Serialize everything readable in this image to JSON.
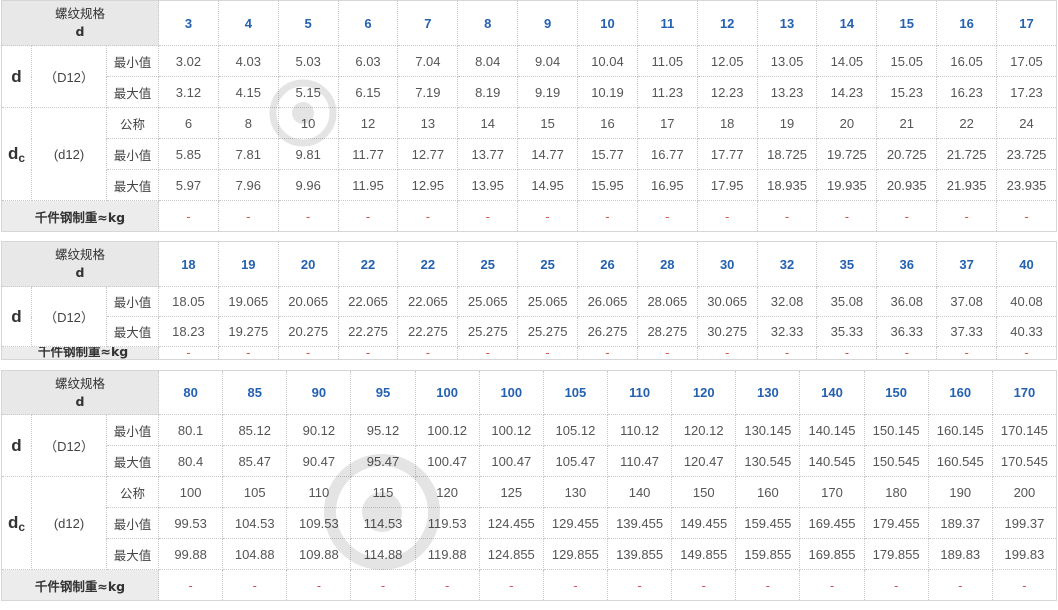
{
  "blocks": [
    {
      "thread_label": "螺纹规格",
      "thread_symbol": "d",
      "sizes": [
        "3",
        "4",
        "5",
        "6",
        "7",
        "8",
        "9",
        "10",
        "11",
        "12",
        "13",
        "14",
        "15",
        "16",
        "17"
      ],
      "d": {
        "symbol": "d",
        "tolerance": "（D12）",
        "rows": [
          {
            "label": "最小值",
            "values": [
              "3.02",
              "4.03",
              "5.03",
              "6.03",
              "7.04",
              "8.04",
              "9.04",
              "10.04",
              "11.05",
              "12.05",
              "13.05",
              "14.05",
              "15.05",
              "16.05",
              "17.05"
            ]
          },
          {
            "label": "最大值",
            "values": [
              "3.12",
              "4.15",
              "5.15",
              "6.15",
              "7.19",
              "8.19",
              "9.19",
              "10.19",
              "11.23",
              "12.23",
              "13.23",
              "14.23",
              "15.23",
              "16.23",
              "17.23"
            ]
          }
        ]
      },
      "dc": {
        "symbol": "d",
        "subscript": "c",
        "tolerance": "(d12)",
        "rows": [
          {
            "label": "公称",
            "values": [
              "6",
              "8",
              "10",
              "12",
              "13",
              "14",
              "15",
              "16",
              "17",
              "18",
              "19",
              "20",
              "21",
              "22",
              "24"
            ]
          },
          {
            "label": "最小值",
            "values": [
              "5.85",
              "7.81",
              "9.81",
              "11.77",
              "12.77",
              "13.77",
              "14.77",
              "15.77",
              "16.77",
              "17.77",
              "18.725",
              "19.725",
              "20.725",
              "21.725",
              "23.725"
            ]
          },
          {
            "label": "最大值",
            "values": [
              "5.97",
              "7.96",
              "9.96",
              "11.95",
              "12.95",
              "13.95",
              "14.95",
              "15.95",
              "16.95",
              "17.95",
              "18.935",
              "19.935",
              "20.935",
              "21.935",
              "23.935"
            ]
          }
        ]
      },
      "weight": {
        "label": "千件钢制重≈kg",
        "values": [
          "-",
          "-",
          "-",
          "-",
          "-",
          "-",
          "-",
          "-",
          "-",
          "-",
          "-",
          "-",
          "-",
          "-",
          "-"
        ]
      }
    },
    {
      "thread_label": "螺纹规格",
      "thread_symbol": "d",
      "sizes": [
        "18",
        "19",
        "20",
        "22",
        "22",
        "25",
        "25",
        "26",
        "28",
        "30",
        "32",
        "35",
        "36",
        "37",
        "40"
      ],
      "d": {
        "symbol": "d",
        "tolerance": "（D12）",
        "rows": [
          {
            "label": "最小值",
            "values": [
              "18.05",
              "19.065",
              "20.065",
              "22.065",
              "22.065",
              "25.065",
              "25.065",
              "26.065",
              "28.065",
              "30.065",
              "32.08",
              "35.08",
              "36.08",
              "37.08",
              "40.08"
            ]
          },
          {
            "label": "最大值",
            "values": [
              "18.23",
              "19.275",
              "20.275",
              "22.275",
              "22.275",
              "25.275",
              "25.275",
              "26.275",
              "28.275",
              "30.275",
              "32.33",
              "35.33",
              "36.33",
              "37.33",
              "40.33"
            ]
          }
        ]
      },
      "weight": {
        "label": "千件钢制重≈kg",
        "values": [
          "-",
          "-",
          "-",
          "-",
          "-",
          "-",
          "-",
          "-",
          "-",
          "-",
          "-",
          "-",
          "-",
          "-",
          "-"
        ]
      }
    },
    {
      "thread_label": "螺纹规格",
      "thread_symbol": "d",
      "sizes": [
        "80",
        "85",
        "90",
        "95",
        "100",
        "100",
        "105",
        "110",
        "120",
        "130",
        "140",
        "150",
        "160",
        "170"
      ],
      "d": {
        "symbol": "d",
        "tolerance": "（D12）",
        "rows": [
          {
            "label": "最小值",
            "values": [
              "80.1",
              "85.12",
              "90.12",
              "95.12",
              "100.12",
              "100.12",
              "105.12",
              "110.12",
              "120.12",
              "130.145",
              "140.145",
              "150.145",
              "160.145",
              "170.145"
            ]
          },
          {
            "label": "最大值",
            "values": [
              "80.4",
              "85.47",
              "90.47",
              "95.47",
              "100.47",
              "100.47",
              "105.47",
              "110.47",
              "120.47",
              "130.545",
              "140.545",
              "150.545",
              "160.545",
              "170.545"
            ]
          }
        ]
      },
      "dc": {
        "symbol": "d",
        "subscript": "c",
        "tolerance": "(d12)",
        "rows": [
          {
            "label": "公称",
            "values": [
              "100",
              "105",
              "110",
              "115",
              "120",
              "125",
              "130",
              "140",
              "150",
              "160",
              "170",
              "180",
              "190",
              "200"
            ]
          },
          {
            "label": "最小值",
            "values": [
              "99.53",
              "104.53",
              "109.53",
              "114.53",
              "119.53",
              "124.455",
              "129.455",
              "139.455",
              "149.455",
              "159.455",
              "169.455",
              "179.455",
              "189.37",
              "199.37"
            ]
          },
          {
            "label": "最大值",
            "values": [
              "99.88",
              "104.88",
              "109.88",
              "114.88",
              "119.88",
              "124.855",
              "129.855",
              "139.855",
              "149.855",
              "159.855",
              "169.855",
              "179.855",
              "189.83",
              "199.83"
            ]
          }
        ]
      },
      "weight": {
        "label": "千件钢制重≈kg",
        "values": [
          "-",
          "-",
          "-",
          "-",
          "-",
          "-",
          "-",
          "-",
          "-",
          "-",
          "-",
          "-",
          "-",
          "-"
        ]
      }
    }
  ]
}
